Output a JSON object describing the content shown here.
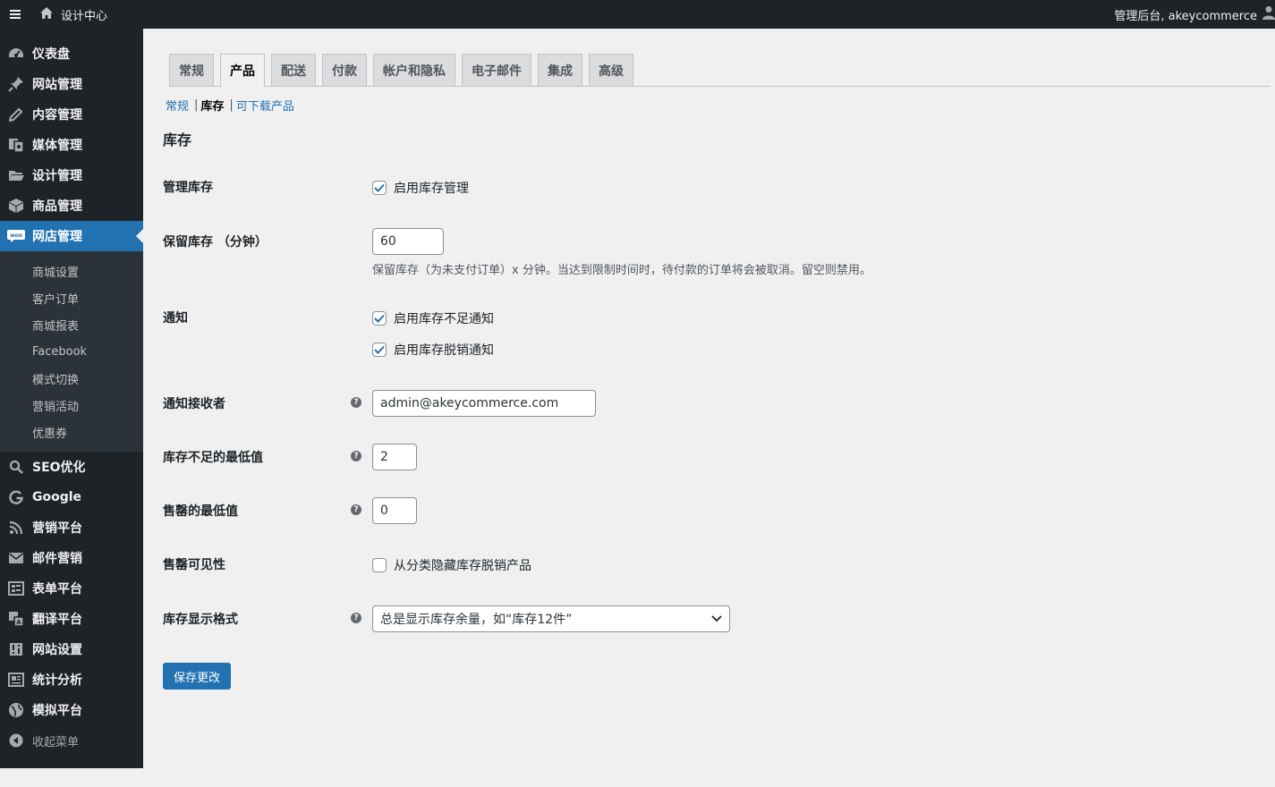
{
  "adminbar": {
    "site_name": "设计中心",
    "greeting": "管理后台, akeycommerce"
  },
  "sidebar": {
    "items": [
      {
        "label": "仪表盘",
        "icon": "dashboard-icon"
      },
      {
        "label": "网站管理",
        "icon": "pin-icon"
      },
      {
        "label": "内容管理",
        "icon": "pencil-icon"
      },
      {
        "label": "媒体管理",
        "icon": "media-icon"
      },
      {
        "label": "设计管理",
        "icon": "folder-icon"
      },
      {
        "label": "商品管理",
        "icon": "box-icon"
      },
      {
        "label": "网店管理",
        "icon": "woo-icon"
      }
    ],
    "submenu": [
      "商城设置",
      "客户订单",
      "商城报表",
      "Facebook",
      "模式切换",
      "营销活动",
      "优惠券"
    ],
    "items_after": [
      {
        "label": "SEO优化",
        "icon": "search-icon"
      },
      {
        "label": "Google",
        "icon": "google-icon"
      },
      {
        "label": "营销平台",
        "icon": "rss-icon"
      },
      {
        "label": "邮件营销",
        "icon": "mail-icon"
      },
      {
        "label": "表单平台",
        "icon": "form-icon"
      },
      {
        "label": "翻译平台",
        "icon": "translate-icon"
      },
      {
        "label": "网站设置",
        "icon": "settings-icon"
      },
      {
        "label": "统计分析",
        "icon": "stats-icon"
      },
      {
        "label": "模拟平台",
        "icon": "globe-icon"
      }
    ],
    "collapse_label": "收起菜单"
  },
  "tabs": [
    "常规",
    "产品",
    "配送",
    "付款",
    "帐户和隐私",
    "电子邮件",
    "集成",
    "高级"
  ],
  "active_tab": "产品",
  "subsub": {
    "general": "常规",
    "inventory": "库存",
    "downloadable": "可下载产品"
  },
  "section_title": "库存",
  "form": {
    "manage_stock": {
      "label": "管理库存",
      "checkbox_label": "启用库存管理",
      "checked": true
    },
    "hold_stock": {
      "label": "保留库存 （分钟）",
      "value": "60",
      "description": "保留库存（为未支付订单）x 分钟。当达到限制时间时，待付款的订单将会被取消。留空则禁用。"
    },
    "notifications": {
      "label": "通知",
      "low_stock_label": "启用库存不足通知",
      "out_of_stock_label": "启用库存脱销通知",
      "low_checked": true,
      "out_checked": true
    },
    "recipient": {
      "label": "通知接收者",
      "value": "admin@akeycommerce.com"
    },
    "low_threshold": {
      "label": "库存不足的最低值",
      "value": "2"
    },
    "out_threshold": {
      "label": "售罄的最低值",
      "value": "0"
    },
    "visibility": {
      "label": "售罄可见性",
      "checkbox_label": "从分类隐藏库存脱销产品",
      "checked": false
    },
    "display_format": {
      "label": "库存显示格式",
      "value": "总是显示库存余量，如“库存12件”"
    }
  },
  "save_button": "保存更改",
  "colors": {
    "accent": "#2271b1",
    "sidebar_bg": "#1d2327",
    "submenu_bg": "#2c3338"
  }
}
